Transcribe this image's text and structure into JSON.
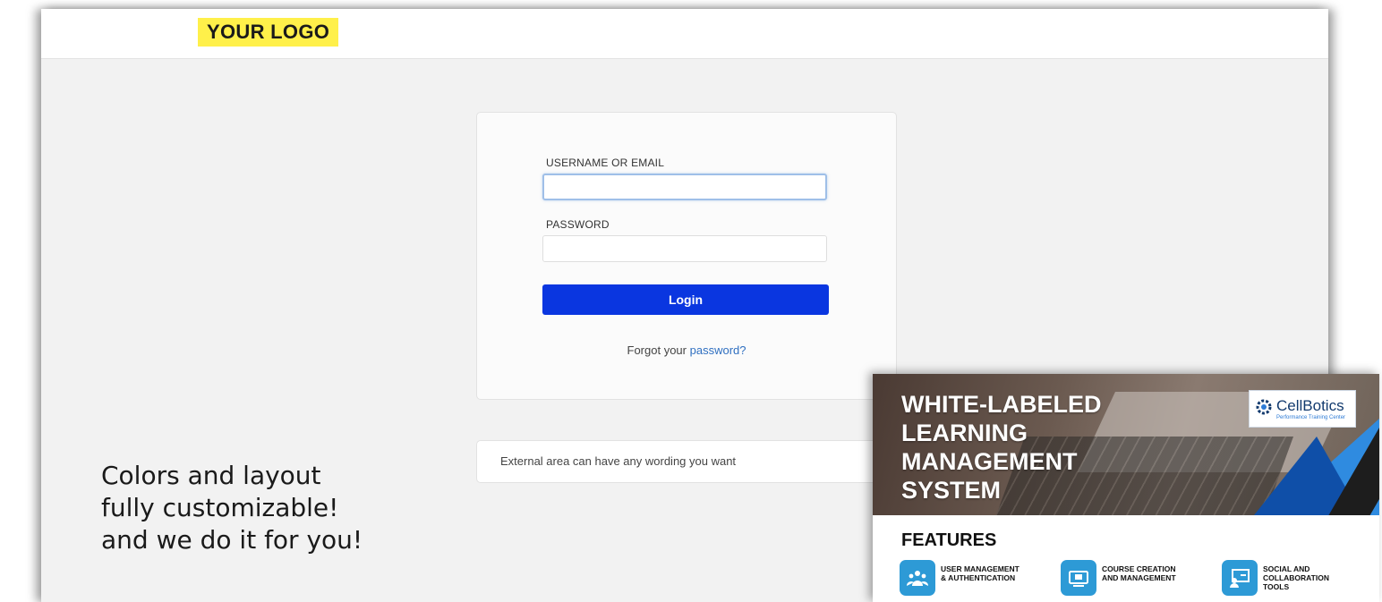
{
  "header": {
    "logo_text": "YOUR LOGO"
  },
  "login": {
    "username_label": "USERNAME OR EMAIL",
    "username_value": "",
    "password_label": "PASSWORD",
    "password_value": "",
    "login_button": "Login",
    "forgot_prefix": "Forgot your ",
    "forgot_link": "password?"
  },
  "external": {
    "text": "External area can have any wording you want"
  },
  "caption": {
    "line1": "Colors and layout",
    "line2": "fully customizable!",
    "line3": "and we do it for you!"
  },
  "flyer": {
    "title_lines": [
      "WHITE-LABELED",
      "LEARNING",
      "MANAGEMENT",
      "SYSTEM"
    ],
    "brand_name": "CellBotics",
    "brand_sub": "Performance Training Center",
    "features_title": "FEATURES",
    "features": [
      {
        "line1": "USER MANAGEMENT",
        "line2": "& AUTHENTICATION",
        "line3": "",
        "icon": "users-icon"
      },
      {
        "line1": "COURSE CREATION",
        "line2": "AND MANAGEMENT",
        "line3": "",
        "icon": "course-icon"
      },
      {
        "line1": "SOCIAL AND",
        "line2": "COLLABORATION",
        "line3": "TOOLS",
        "icon": "collaboration-icon"
      }
    ]
  },
  "colors": {
    "logo_bg": "#fff04a",
    "login_button": "#0a36e0",
    "link": "#2f6fc0",
    "feature_icon": "#2d9ad6"
  }
}
